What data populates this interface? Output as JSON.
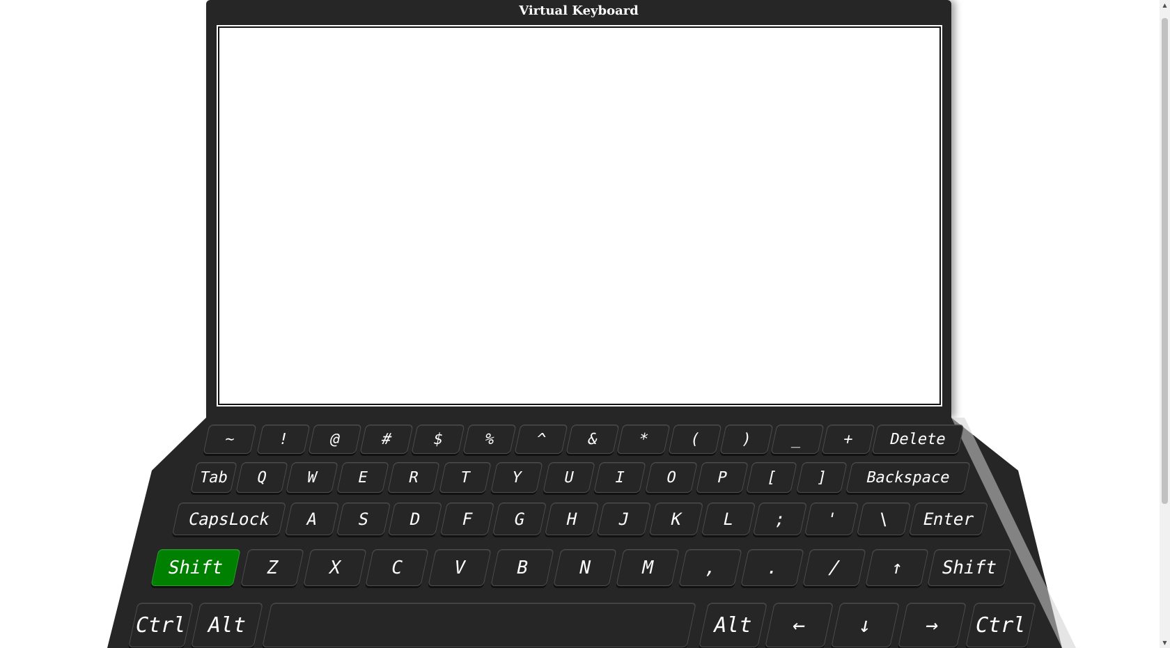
{
  "screen": {
    "title": "Virtual Keyboard",
    "text_value": ""
  },
  "keyboard": {
    "rows": [
      [
        "~",
        "!",
        "@",
        "#",
        "$",
        "%",
        "^",
        "&",
        "*",
        "(",
        ")",
        "_",
        "+",
        "Delete"
      ],
      [
        "Tab",
        "Q",
        "W",
        "E",
        "R",
        "T",
        "Y",
        "U",
        "I",
        "O",
        "P",
        "[",
        "]",
        "Backspace"
      ],
      [
        "CapsLock",
        "A",
        "S",
        "D",
        "F",
        "G",
        "H",
        "J",
        "K",
        "L",
        ";",
        "'",
        "\\",
        "Enter"
      ],
      [
        "Shift",
        "Z",
        "X",
        "C",
        "V",
        "B",
        "N",
        "M",
        ",",
        ".",
        "/",
        "↑",
        "Shift"
      ],
      [
        "Ctrl",
        "Alt",
        "",
        "Alt",
        "←",
        "↓",
        "→",
        "Ctrl"
      ]
    ],
    "active_key": "Shift (left)",
    "active_color": "#008000"
  },
  "colors": {
    "body": "#262626",
    "key_text": "#ffffff",
    "background": "#ffffff"
  }
}
